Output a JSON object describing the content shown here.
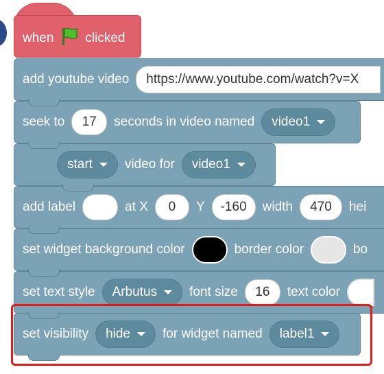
{
  "hat": {
    "when": "when",
    "clicked": "clicked",
    "flag_icon": "green-flag-icon",
    "color": "#e0616b"
  },
  "blocks": {
    "add_video": {
      "label": "add youtube video",
      "url": "https://www.youtube.com/watch?v=X"
    },
    "seek": {
      "label": "seek to",
      "seconds": "17",
      "mid": "seconds in video named",
      "video": "video1"
    },
    "start": {
      "action": "start",
      "mid": "video for",
      "video": "video1"
    },
    "add_label": {
      "label": "add label",
      "text": "",
      "at_x": "at X",
      "x": "0",
      "y_label": "Y",
      "y": "-160",
      "width_label": "width",
      "width": "470",
      "height_label": "hei"
    },
    "widget_bg": {
      "label": "set widget background color",
      "bg_color": "#000000",
      "border_label": "border color",
      "border_color": "#e6e6e6",
      "extra": "bo"
    },
    "text_style": {
      "label": "set text style",
      "font": "Arbutus",
      "size_label": "font size",
      "size": "16",
      "color_label": "text color",
      "text_color": "#ffffff"
    },
    "visibility": {
      "label": "set visibility",
      "mode": "hide",
      "mid": "for widget named",
      "widget": "label1"
    }
  }
}
